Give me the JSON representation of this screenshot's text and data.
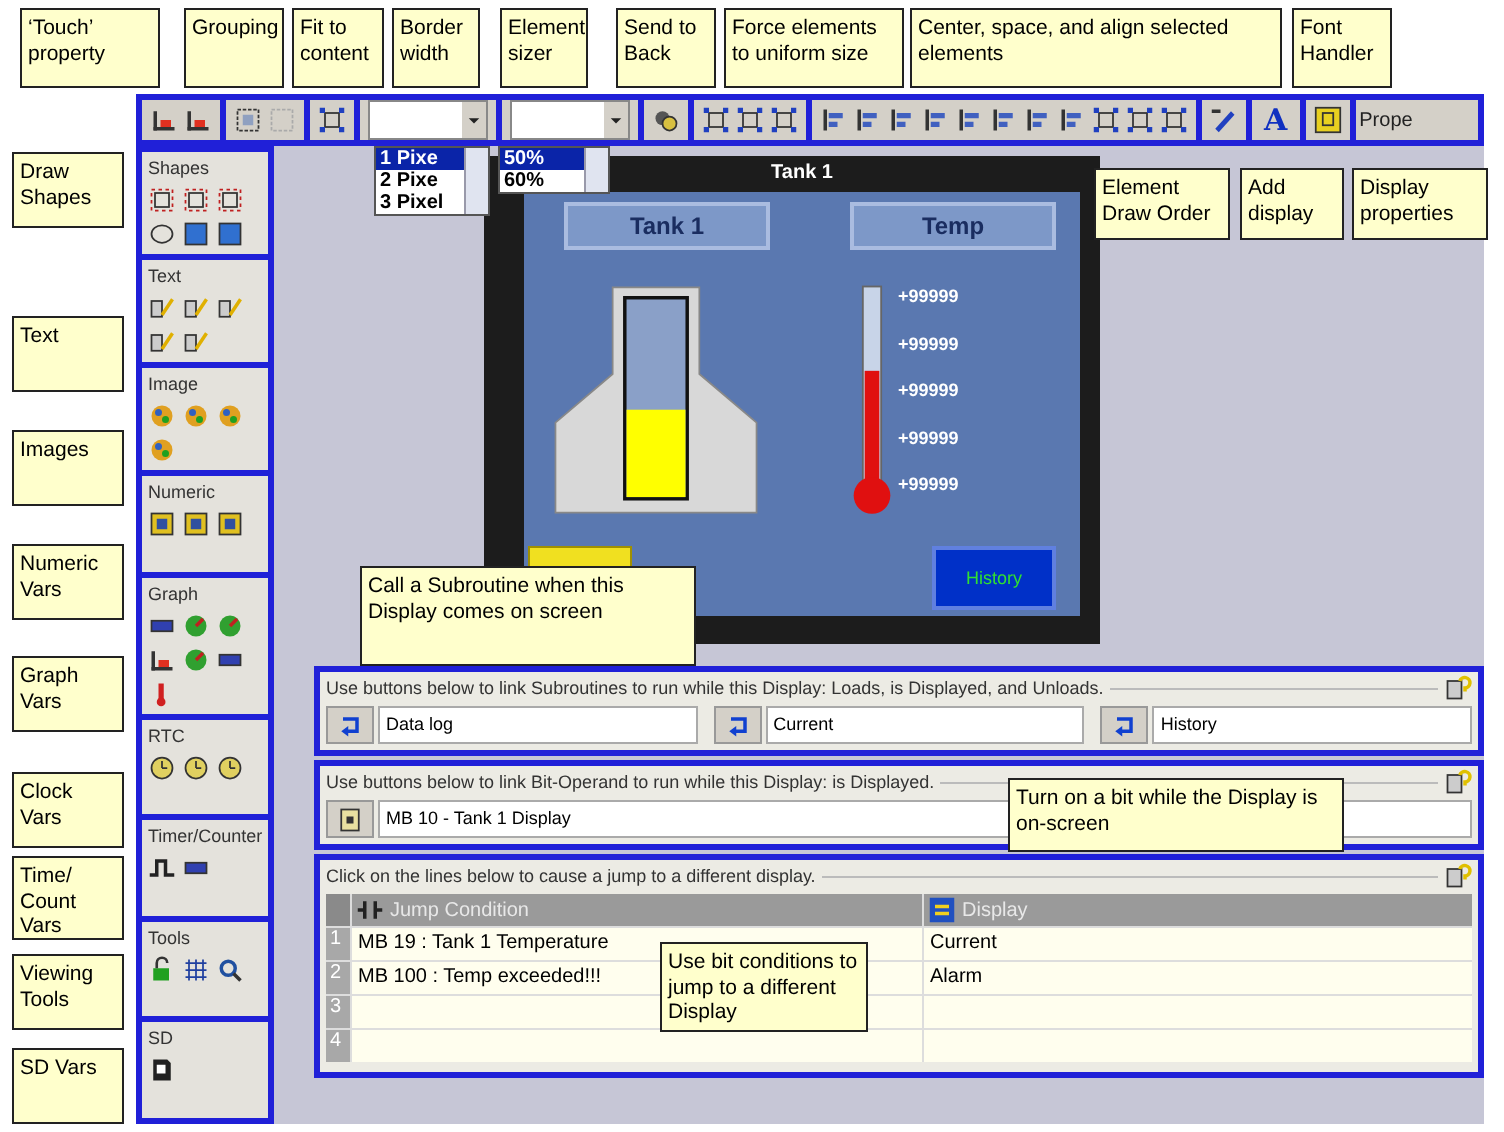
{
  "callouts": [
    {
      "text": "‘Touch’ property"
    },
    {
      "text": "Grouping"
    },
    {
      "text": "Fit to content"
    },
    {
      "text": "Border width"
    },
    {
      "text": "Element sizer"
    },
    {
      "text": "Send to Back"
    },
    {
      "text": "Force elements to uniform size"
    },
    {
      "text": "Center, space, and align selected elements"
    },
    {
      "text": "Font Handler"
    },
    {
      "text": "Element Draw Order"
    },
    {
      "text": "Add display"
    },
    {
      "text": "Display properties"
    },
    {
      "text": "Draw Shapes"
    },
    {
      "text": "Text"
    },
    {
      "text": "Images"
    },
    {
      "text": "Numeric Vars"
    },
    {
      "text": "Graph Vars"
    },
    {
      "text": "Clock Vars"
    },
    {
      "text": "Time/ Count Vars"
    },
    {
      "text": "Viewing Tools"
    },
    {
      "text": "SD Vars"
    },
    {
      "text": "Call a Subroutine when this Display comes on screen"
    },
    {
      "text": "Turn on a bit while the Display is on-screen"
    },
    {
      "text": "Use bit conditions to jump to a different Display"
    }
  ],
  "toolbar": {
    "font_button": "A",
    "properties_button": "Prope",
    "border_width_list": [
      {
        "label": "1 Pixe",
        "selected": true
      },
      {
        "label": "2 Pixe",
        "selected": false
      },
      {
        "label": "3 Pixel",
        "selected": false
      }
    ],
    "element_sizer_list": [
      {
        "label": "50%",
        "selected": true
      },
      {
        "label": "60%",
        "selected": false
      }
    ]
  },
  "palette": [
    {
      "title": "Shapes"
    },
    {
      "title": "Text"
    },
    {
      "title": "Image"
    },
    {
      "title": "Numeric"
    },
    {
      "title": "Graph"
    },
    {
      "title": "RTC"
    },
    {
      "title": "Timer/Counter"
    },
    {
      "title": "Tools"
    },
    {
      "title": "SD"
    }
  ],
  "display_preview": {
    "title": "Tank 1",
    "labels": [
      "Tank 1",
      "Temp"
    ],
    "tank": {
      "level": 0.45
    },
    "thermometer": {
      "level": 0.6
    },
    "readings": [
      "+99999",
      "+99999",
      "+99999",
      "+99999",
      "+99999"
    ],
    "history_button": "History"
  },
  "subroutines": {
    "caption": "Use buttons below to link Subroutines to run while this Display:  Loads, is Displayed, and Unloads.",
    "slots": [
      "Data log",
      "Current",
      "History"
    ]
  },
  "bit_operand": {
    "caption": "Use buttons below to link Bit-Operand to run while this Display: is Displayed.",
    "value": "MB 10  - Tank 1 Display"
  },
  "jumps": {
    "caption": "Click on the lines below to cause a jump to a different display.",
    "columns": [
      "Jump Condition",
      "Display"
    ],
    "rows": [
      {
        "number": "1",
        "condition": "MB 19 : Tank 1 Temperature",
        "display": "Current"
      },
      {
        "number": "2",
        "condition": "MB 100 : Temp exceeded!!!",
        "display": "Alarm"
      },
      {
        "number": "3"
      },
      {
        "number": "4"
      }
    ]
  }
}
